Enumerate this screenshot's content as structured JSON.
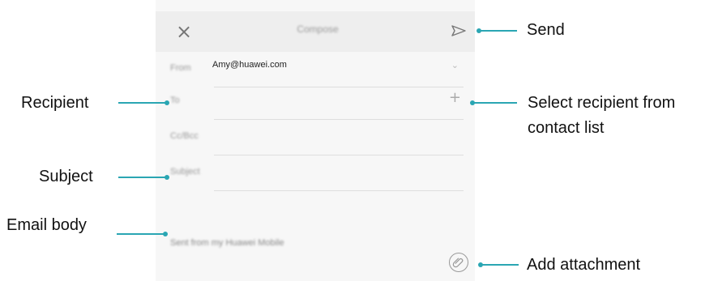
{
  "compose": {
    "title": "Compose",
    "from_label": "From",
    "from_value": "Amy@huawei.com",
    "to_label": "To",
    "cc_label": "Cc/Bcc",
    "subject_label": "Subject",
    "body_placeholder": "Sent from my Huawei Mobile"
  },
  "callouts": {
    "send": "Send",
    "select_recipient_line1": "Select recipient from",
    "select_recipient_line2": "contact list",
    "recipient": "Recipient",
    "subject": "Subject",
    "email_body": "Email body",
    "add_attachment": "Add attachment"
  },
  "colors": {
    "accent": "#2aa6b3",
    "screen_bg": "#f7f7f7",
    "toolbar_bg": "#eeeeee"
  },
  "icons": {
    "close": "close-icon",
    "send": "send-icon",
    "chevron": "chevron-down-icon",
    "add_contact": "plus-icon",
    "attachment": "paperclip-icon"
  }
}
